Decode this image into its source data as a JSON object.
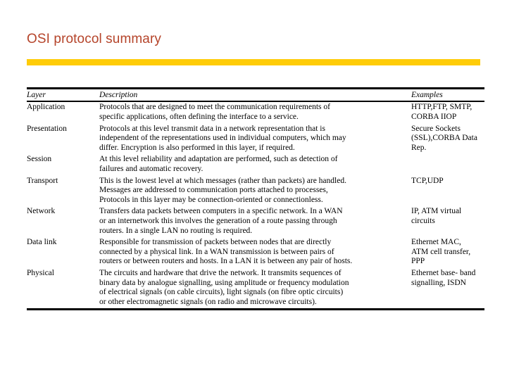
{
  "slide": {
    "title": "OSI protocol summary",
    "title_color": "#b5442a",
    "accent_bar_color": "#ffcc08",
    "background_color": "#ffffff"
  },
  "table": {
    "headers": {
      "layer": "Layer",
      "description": "Description",
      "examples": "Examples"
    },
    "rows": [
      {
        "layer": "Application",
        "description_lines": [
          "Protocols that are designed to meet the communication requirements of",
          "specific applications, often defining the interface to a service."
        ],
        "examples_lines": [
          "HTTP,FTP, SMTP,",
          "CORBA IIOP"
        ]
      },
      {
        "layer": "Presentation",
        "description_lines": [
          "Protocols at this level transmit data in a network representation that is",
          "independent of the representations used in individual computers, which may",
          "differ. Encryption is also performed in this layer, if required."
        ],
        "examples_lines": [
          "Secure Sockets",
          "(SSL),CORBA Data",
          "Rep."
        ]
      },
      {
        "layer": "Session",
        "description_lines": [
          "At this level reliability and adaptation are performed, such as detection of",
          "failures and automatic recovery."
        ],
        "examples_lines": []
      },
      {
        "layer": "Transport",
        "description_lines": [
          "This is the lowest level at which messages (rather than packets) are handled.",
          "Messages are addressed to communication ports attached to processes,",
          "Protocols in this layer may be connection-oriented or connectionless."
        ],
        "examples_lines": [
          "TCP,UDP"
        ]
      },
      {
        "layer": "Network",
        "description_lines": [
          "Transfers data packets between computers in a specific network. In a WAN",
          "or an internetwork this involves the generation of a route passing through",
          "routers. In a single LAN no routing is required."
        ],
        "examples_lines": [
          "IP, ATM virtual",
          "circuits"
        ]
      },
      {
        "layer": "Data link",
        "description_lines": [
          "Responsible for transmission of packets between nodes that are directly",
          "connected by a physical link. In a WAN transmission is between pairs of",
          "routers or between routers and hosts. In a LAN it is between any pair of hosts."
        ],
        "examples_lines": [
          "Ethernet MAC,",
          "ATM cell transfer,",
          "PPP"
        ]
      },
      {
        "layer": "Physical",
        "description_lines": [
          "The circuits and hardware that drive the network. It transmits sequences of",
          "binary data by analogue signalling, using amplitude or frequency modulation",
          "of electrical signals (on cable circuits), light signals (on fibre optic circuits)",
          "or other electromagnetic signals (on radio and microwave circuits)."
        ],
        "examples_lines": [
          "Ethernet base- band",
          "signalling,  ISDN"
        ]
      }
    ]
  }
}
